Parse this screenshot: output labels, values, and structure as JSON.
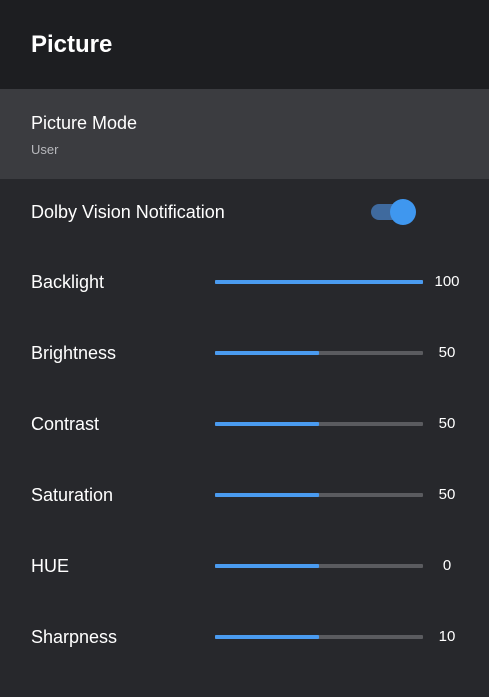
{
  "header": {
    "title": "Picture"
  },
  "picture_mode": {
    "label": "Picture Mode",
    "value": "User"
  },
  "dolby": {
    "label": "Dolby Vision Notification",
    "enabled": true
  },
  "sliders": [
    {
      "label": "Backlight",
      "value": "100",
      "fill_fraction": 1.0
    },
    {
      "label": "Brightness",
      "value": "50",
      "fill_fraction": 0.5
    },
    {
      "label": "Contrast",
      "value": "50",
      "fill_fraction": 0.5
    },
    {
      "label": "Saturation",
      "value": "50",
      "fill_fraction": 0.5
    },
    {
      "label": "HUE",
      "value": "0",
      "fill_fraction": 0.5
    },
    {
      "label": "Sharpness",
      "value": "10",
      "fill_fraction": 0.5
    }
  ],
  "colors": {
    "background": "#27282c",
    "header_background": "#1d1e21",
    "selected_row": "#3b3c40",
    "accent": "#4a9bf0",
    "track": "#5a5b5f"
  }
}
